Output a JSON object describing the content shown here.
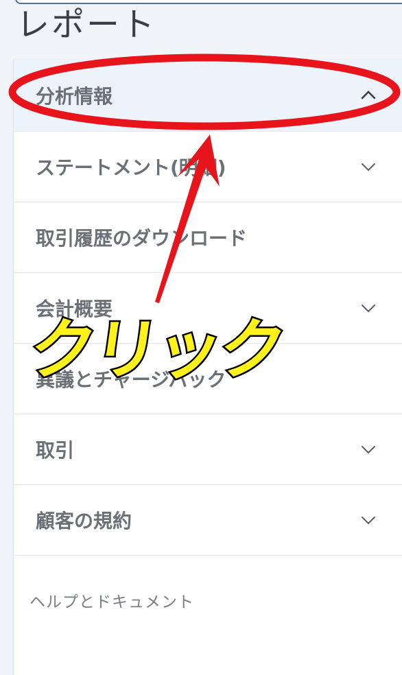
{
  "page": {
    "title": "レポート"
  },
  "menu": {
    "items": [
      {
        "label": "分析情報",
        "expanded": true,
        "icon": "chevron-up-icon"
      },
      {
        "label": "ステートメント(明細)",
        "expanded": false,
        "icon": "chevron-down-icon"
      },
      {
        "label": "取引履歴のダウンロード",
        "expanded": false,
        "icon": ""
      },
      {
        "label": "会計概要",
        "expanded": false,
        "icon": "chevron-down-icon"
      },
      {
        "label": "異議とチャージバック",
        "expanded": false,
        "icon": ""
      },
      {
        "label": "取引",
        "expanded": false,
        "icon": "chevron-down-icon"
      },
      {
        "label": "顧客の規約",
        "expanded": false,
        "icon": "chevron-down-icon"
      }
    ],
    "help_label": "ヘルプとドキュメント"
  },
  "annotation": {
    "callout_text": "クリック",
    "highlight_color": "#e8141b",
    "callout_color": "#fff21a"
  }
}
